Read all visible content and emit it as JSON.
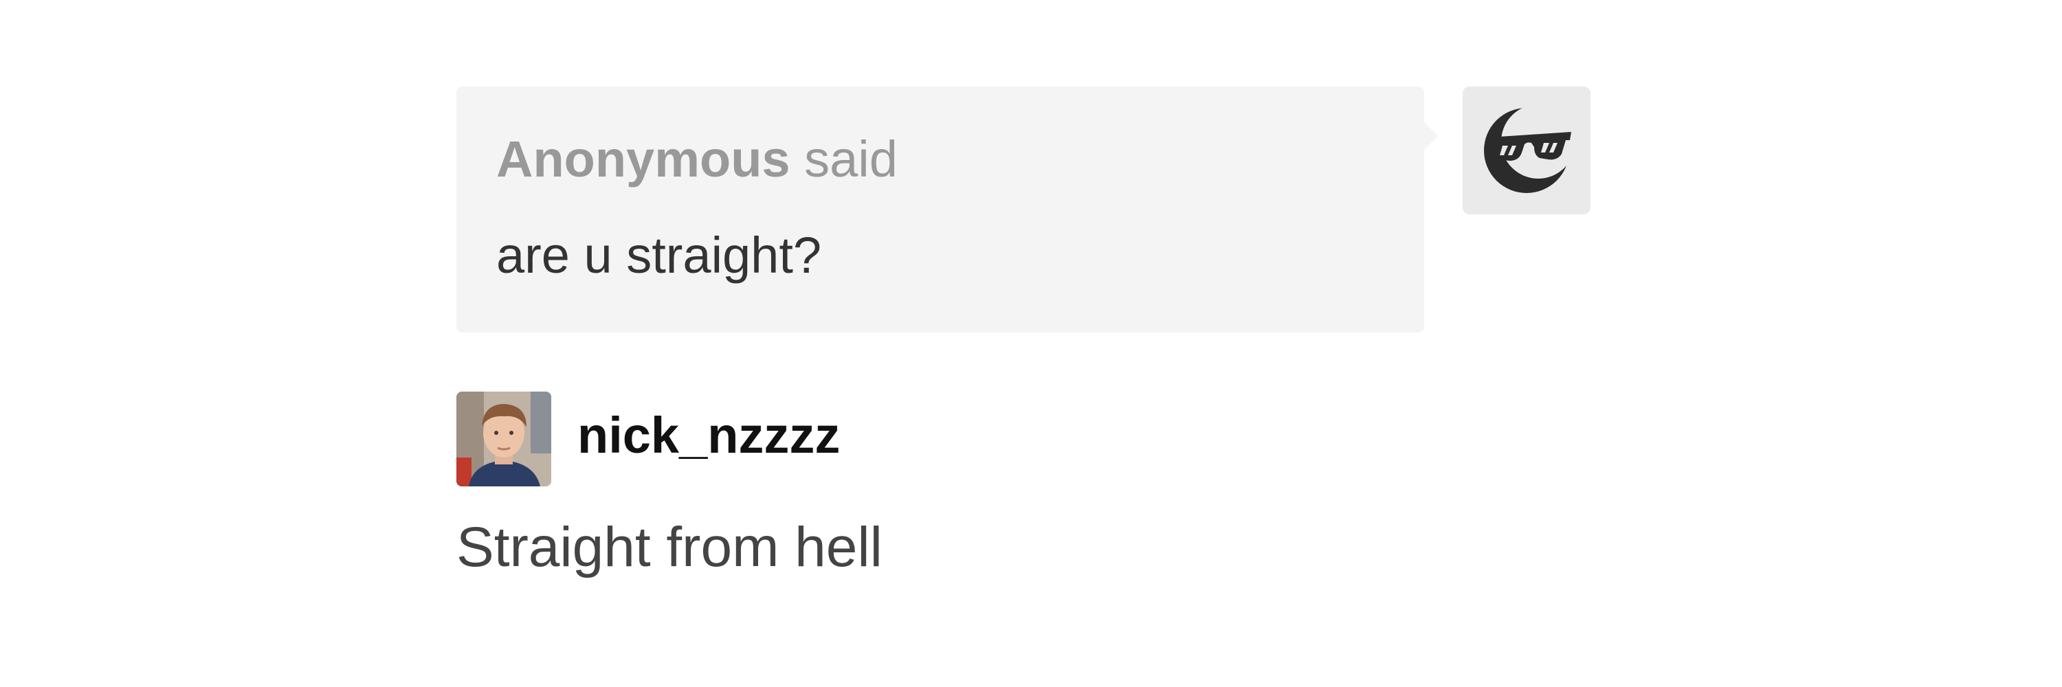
{
  "ask": {
    "asker_name": "Anonymous",
    "asker_suffix": " said",
    "question": "are u straight?",
    "avatar_icon": "sunglasses-face-icon"
  },
  "answer": {
    "username": "nick_nzzzz",
    "avatar_icon": "user-avatar-photo",
    "text": "Straight from hell"
  },
  "colors": {
    "bubble_background": "#f4f4f4",
    "asker_text": "#999999",
    "question_text": "#333333",
    "username_text": "#111111",
    "answer_text": "#444444"
  }
}
